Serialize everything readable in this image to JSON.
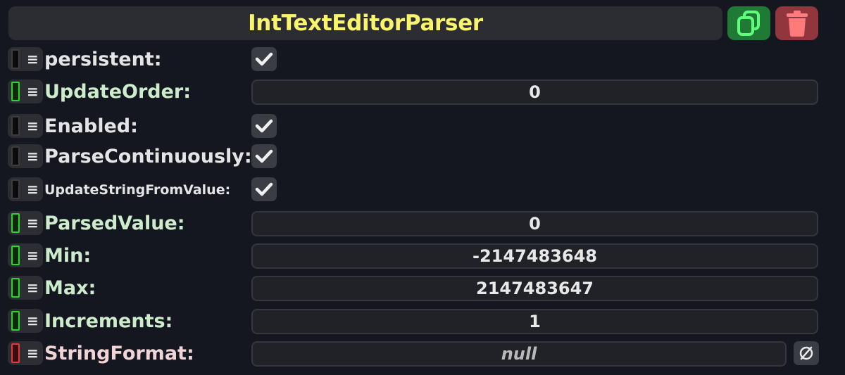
{
  "header": {
    "title": "IntTextEditorParser",
    "copy_icon": "copy-icon",
    "delete_icon": "trash-icon"
  },
  "colors": {
    "title": "#f9f46a",
    "copy_button": "#1f7a35",
    "delete_button": "#92363e",
    "indicator_green": "#2bd62b",
    "indicator_red": "#e03a3a"
  },
  "fields": [
    {
      "label": "persistent:",
      "type": "checkbox",
      "checked": true,
      "indicator": "off"
    },
    {
      "label": "UpdateOrder:",
      "type": "value",
      "value": "0",
      "indicator": "green"
    },
    {
      "label": "Enabled:",
      "type": "checkbox",
      "checked": true,
      "indicator": "off"
    },
    {
      "label": "ParseContinuously:",
      "type": "checkbox",
      "checked": true,
      "indicator": "off"
    },
    {
      "label": "UpdateStringFromValue:",
      "type": "checkbox",
      "checked": true,
      "indicator": "off"
    },
    {
      "label": "ParsedValue:",
      "type": "value",
      "value": "0",
      "indicator": "green"
    },
    {
      "label": "Min:",
      "type": "value",
      "value": "-2147483648",
      "indicator": "green"
    },
    {
      "label": "Max:",
      "type": "value",
      "value": "2147483647",
      "indicator": "green"
    },
    {
      "label": "Increments:",
      "type": "value",
      "value": "1",
      "indicator": "green"
    },
    {
      "label": "StringFormat:",
      "type": "value",
      "value": "null",
      "indicator": "red",
      "null_button_icon": "null-icon"
    }
  ]
}
